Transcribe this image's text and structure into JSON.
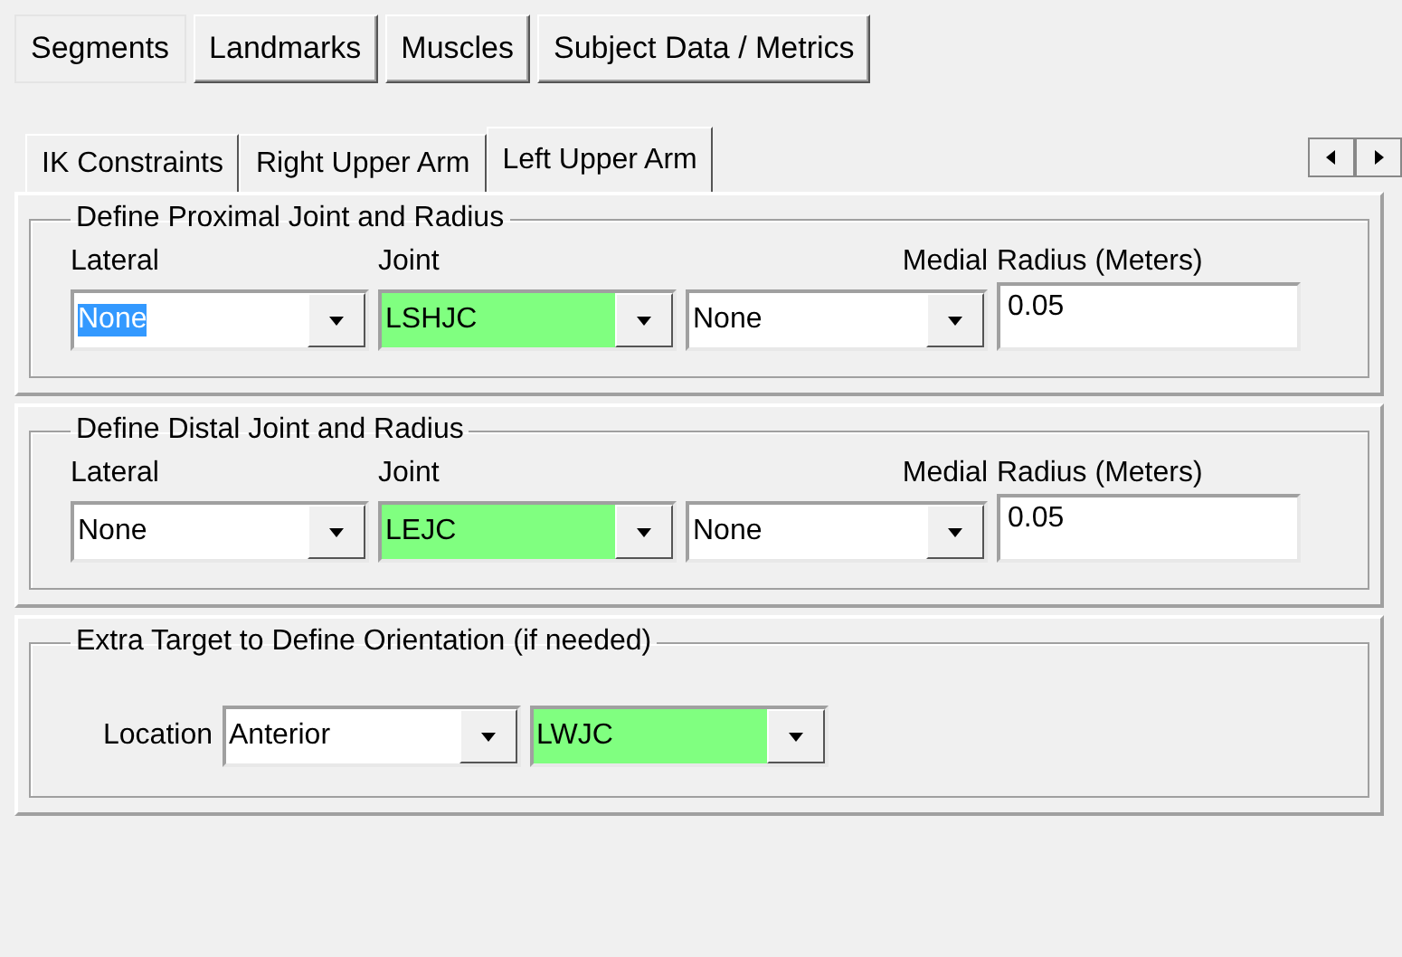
{
  "top_tabs": [
    {
      "label": "Segments",
      "selected": true
    },
    {
      "label": "Landmarks",
      "selected": false
    },
    {
      "label": "Muscles",
      "selected": false
    },
    {
      "label": "Subject Data / Metrics",
      "selected": false
    }
  ],
  "sub_tabs": [
    {
      "label": "IK Constraints",
      "selected": false
    },
    {
      "label": "Right Upper Arm",
      "selected": false
    },
    {
      "label": "Left Upper Arm",
      "selected": true
    }
  ],
  "sections": [
    {
      "kind": "joint",
      "title": "Define Proximal Joint and Radius",
      "labels": {
        "lateral": "Lateral",
        "joint": "Joint",
        "medial": "Medial",
        "radius": "Radius (Meters)"
      },
      "combos": [
        {
          "value": "None",
          "color": "#ffffff",
          "focused": true
        },
        {
          "value": "LSHJC",
          "color": "#80ff80",
          "focused": false
        },
        {
          "value": "None",
          "color": "#ffffff",
          "focused": false
        }
      ],
      "radius": "0.05"
    },
    {
      "kind": "joint",
      "title": "Define Distal Joint and Radius",
      "labels": {
        "lateral": "Lateral",
        "joint": "Joint",
        "medial": "Medial",
        "radius": "Radius (Meters)"
      },
      "combos": [
        {
          "value": "None",
          "color": "#ffffff",
          "focused": false
        },
        {
          "value": "LEJC",
          "color": "#80ff80",
          "focused": false
        },
        {
          "value": "None",
          "color": "#ffffff",
          "focused": false
        }
      ],
      "radius": "0.05"
    },
    {
      "kind": "orientation",
      "title": "Extra Target to Define Orientation (if needed)",
      "label": "Location",
      "combos": [
        {
          "value": "Anterior",
          "color": "#ffffff",
          "focused": false
        },
        {
          "value": "LWJC",
          "color": "#80ff80",
          "focused": false
        }
      ]
    }
  ]
}
